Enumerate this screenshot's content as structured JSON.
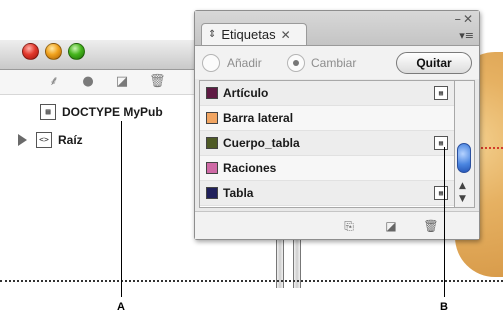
{
  "structure_window": {
    "tree": [
      {
        "label": "DOCTYPE MyPub",
        "icon": "doctype-icon",
        "expandable": false
      },
      {
        "label": "Raíz",
        "icon": "element-icon",
        "expandable": true
      }
    ],
    "toolbar_icons": [
      "tag-text-icon",
      "dot-icon",
      "new-element-icon",
      "trash-icon"
    ]
  },
  "tags_panel": {
    "tab_label": "Etiquetas",
    "options": {
      "add_label": "Añadir",
      "change_label": "Cambiar",
      "selected": "Cambiar",
      "remove_label": "Quitar"
    },
    "tags": [
      {
        "label": "Artículo",
        "color": "#5e1a43",
        "has_icon": true
      },
      {
        "label": "Barra lateral",
        "color": "#f1a562",
        "has_icon": false
      },
      {
        "label": "Cuerpo_tabla",
        "color": "#4e5a25",
        "has_icon": true
      },
      {
        "label": "Raciones",
        "color": "#cf6aa6",
        "has_icon": false
      },
      {
        "label": "Tabla",
        "color": "#1f1f5a",
        "has_icon": true
      }
    ],
    "footer_icons": [
      "map-tags-icon",
      "new-tag-icon",
      "trash-icon"
    ]
  },
  "callouts": {
    "a": "A",
    "b": "B"
  }
}
